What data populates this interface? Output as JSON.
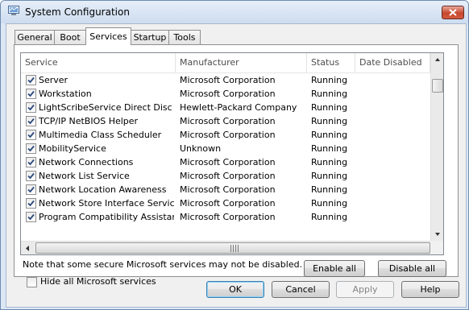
{
  "window": {
    "title": "System Configuration"
  },
  "tabs": [
    "General",
    "Boot",
    "Services",
    "Startup",
    "Tools"
  ],
  "active_tab": "Services",
  "columns": [
    "Service",
    "Manufacturer",
    "Status",
    "Date Disabled"
  ],
  "services": [
    {
      "name": "Server",
      "manufacturer": "Microsoft Corporation",
      "status": "Running",
      "date_disabled": "",
      "checked": true
    },
    {
      "name": "Workstation",
      "manufacturer": "Microsoft Corporation",
      "status": "Running",
      "date_disabled": "",
      "checked": true
    },
    {
      "name": "LightScribeService Direct Disc La...",
      "manufacturer": "Hewlett-Packard Company",
      "status": "Running",
      "date_disabled": "",
      "checked": true
    },
    {
      "name": "TCP/IP NetBIOS Helper",
      "manufacturer": "Microsoft Corporation",
      "status": "Running",
      "date_disabled": "",
      "checked": true
    },
    {
      "name": "Multimedia Class Scheduler",
      "manufacturer": "Microsoft Corporation",
      "status": "Running",
      "date_disabled": "",
      "checked": true
    },
    {
      "name": "MobilityService",
      "manufacturer": "Unknown",
      "status": "Running",
      "date_disabled": "",
      "checked": true
    },
    {
      "name": "Network Connections",
      "manufacturer": "Microsoft Corporation",
      "status": "Running",
      "date_disabled": "",
      "checked": true
    },
    {
      "name": "Network List Service",
      "manufacturer": "Microsoft Corporation",
      "status": "Running",
      "date_disabled": "",
      "checked": true
    },
    {
      "name": "Network Location Awareness",
      "manufacturer": "Microsoft Corporation",
      "status": "Running",
      "date_disabled": "",
      "checked": true
    },
    {
      "name": "Network Store Interface Service",
      "manufacturer": "Microsoft Corporation",
      "status": "Running",
      "date_disabled": "",
      "checked": true
    },
    {
      "name": "Program Compatibility Assistant ...",
      "manufacturer": "Microsoft Corporation",
      "status": "Running",
      "date_disabled": "",
      "checked": true
    }
  ],
  "note": "Note that some secure Microsoft services may not be disabled.",
  "buttons": {
    "enable_all": "Enable all",
    "disable_all": "Disable all",
    "ok": "OK",
    "cancel": "Cancel",
    "apply": "Apply",
    "help": "Help"
  },
  "hide_ms_services": {
    "label": "Hide all Microsoft services",
    "checked": false
  },
  "icons": {
    "window": "system-configuration-icon",
    "close": "close-icon",
    "check": "checkmark-icon"
  },
  "colors": {
    "frame": "#dbe7f5",
    "close_button": "#c7472e",
    "default_button_border": "#3c7fb1"
  }
}
